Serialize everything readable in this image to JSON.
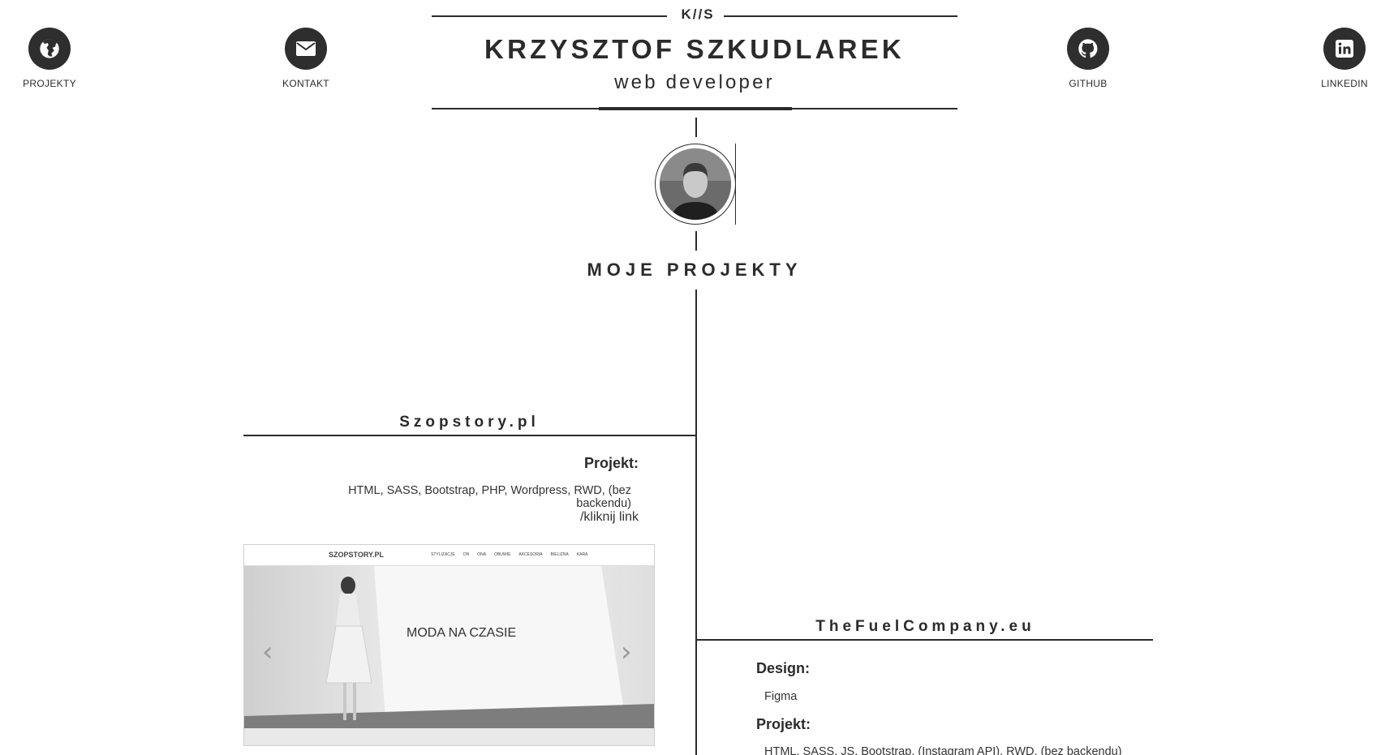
{
  "nav": [
    {
      "label": "PROJEKTY",
      "icon": "globe-icon"
    },
    {
      "label": "KONTAKT",
      "icon": "mail-icon"
    },
    {
      "label": "GITHUB",
      "icon": "github-icon"
    },
    {
      "label": "LINKEDIN",
      "icon": "linkedin-icon"
    }
  ],
  "header": {
    "monogram": "K//S",
    "name": "KRZYSZTOF SZKUDLAREK",
    "role": "web developer"
  },
  "section_title": "MOJE PROJEKTY",
  "projects": [
    {
      "title": "Szopstory.pl",
      "project_label": "Projekt:",
      "technologies": "HTML, SASS, Bootstrap, PHP, Wordpress, RWD, (bez backendu)",
      "link_text": "/kliknij link",
      "screenshot": {
        "logo": "SZOPSTORY.PL",
        "menu": [
          "STYLIZACJE",
          "ON",
          "ONA",
          "OBUWIE",
          "AKCESORIA",
          "BIELIZNA",
          "KARA"
        ],
        "heading": "MODA NA CZASIE"
      }
    },
    {
      "title": "TheFuelCompany.eu",
      "design_label": "Design:",
      "design_tool": "Figma",
      "project_label": "Projekt:",
      "technologies": "HTML, SASS, JS, Bootstrap, (Instagram API), RWD, (bez backendu)"
    }
  ],
  "colors": {
    "primary": "#2e2e2e",
    "text": "#2b2b2b",
    "background": "#ffffff"
  }
}
